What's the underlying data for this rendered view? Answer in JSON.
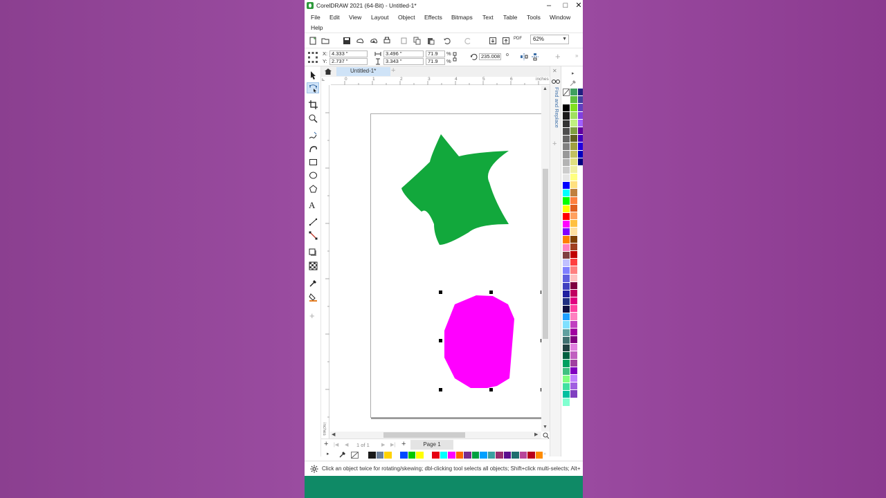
{
  "window": {
    "title": "CorelDRAW 2021 (64-Bit) - Untitled-1*",
    "min_glyph": "–",
    "max_glyph": "□",
    "close_glyph": "✕"
  },
  "menu": {
    "items": [
      "File",
      "Edit",
      "View",
      "Layout",
      "Object",
      "Effects",
      "Bitmaps",
      "Text",
      "Table",
      "Tools",
      "Window",
      "Help"
    ]
  },
  "toolbar": {
    "zoom_value": "62%",
    "pdf_label": "PDF"
  },
  "property_bar": {
    "x_label": "X:",
    "x_value": "4.333 \"",
    "y_label": "Y:",
    "y_value": "2.737 \"",
    "width_value": "3.496 \"",
    "height_value": "3.343 \"",
    "scale_w": "71.9",
    "scale_h": "71.9",
    "percent_symbol": "%",
    "rotation_value": "235.008",
    "degree_symbol": "o"
  },
  "document_tabs": {
    "active_tab": "Untitled-1*",
    "add_glyph": "+"
  },
  "ruler": {
    "unit_label": "inches",
    "h_ticks": [
      "0",
      "1",
      "2",
      "3",
      "4",
      "5",
      "6"
    ],
    "v_unit_label": "inches"
  },
  "page_navigator": {
    "count_text": "1  of  1",
    "page_tab": "Page 1"
  },
  "dockers": {
    "find_replace_title": "Find and Replace"
  },
  "status": {
    "text": "Click an object twice for rotating/skewing; dbl-clicking tool selects all objects; Shift+click multi-selects; Alt+"
  },
  "shapes": {
    "star_color": "#12a83c",
    "octagon_color": "#ff00ff"
  },
  "colors": {
    "accent": "#3b6ea8",
    "status_bar_bottom": "#0f8a66"
  },
  "doc_palette_colors": [
    "#1a1a1a",
    "#6b7f9a",
    "#ffd200",
    "#ffffff",
    "#0048ff",
    "#00c800",
    "#ffff00",
    "#ffffff",
    "#e60012",
    "#00ffff",
    "#ff00ff",
    "#ff6600",
    "#7a2d8e",
    "#00a040",
    "#00a0ff",
    "#3aa0a0",
    "#9a2d6e",
    "#5b0f8e",
    "#1f6e6e",
    "#b8459a",
    "#b8001b",
    "#ff8c00"
  ],
  "palette_col1": [
    "#ffffff",
    "#000000",
    "#1a1a1a",
    "#333333",
    "#4d4d4d",
    "#666666",
    "#808080",
    "#999999",
    "#b3b3b3",
    "#cccccc",
    "#e6e6e6",
    "#0000ff",
    "#00ffff",
    "#00ff00",
    "#ffff00",
    "#ff0000",
    "#ff00ff",
    "#8000ff",
    "#ff8000",
    "#ff80c0",
    "#804040",
    "#c0c0ff",
    "#8080ff",
    "#6060e0",
    "#4040c0",
    "#2020a0",
    "#203080",
    "#101040",
    "#20a0ff",
    "#80e0ff",
    "#60a0a0",
    "#407070",
    "#204040",
    "#006040",
    "#00a060",
    "#40c080",
    "#80ff80",
    "#40e0a0",
    "#00c0a0",
    "#80ffd0"
  ],
  "palette_col2": [
    "#40a060",
    "#60c040",
    "#80e020",
    "#a0e060",
    "#c0f080",
    "#80a040",
    "#606020",
    "#a0a040",
    "#c0c060",
    "#e0e080",
    "#f0f0a0",
    "#ffff80",
    "#ffe080",
    "#c08040",
    "#ff8040",
    "#e06020",
    "#ffa060",
    "#ffc040",
    "#ffe0a0",
    "#804000",
    "#a04020",
    "#c00000",
    "#ff4040",
    "#ff8080",
    "#ffc0c0",
    "#800040",
    "#c00060",
    "#e00080",
    "#ff40a0",
    "#ff80c0",
    "#c040c0",
    "#a000a0",
    "#800080",
    "#e080e0",
    "#c060c0",
    "#a040a0",
    "#8000c0",
    "#c080ff",
    "#a060e0",
    "#8040c0"
  ],
  "palette_col3": [
    "#202080",
    "#4040a0",
    "#6040c0",
    "#8040e0",
    "#a060ff",
    "#6000a0",
    "#4000c0",
    "#2000e0",
    "#0000c0",
    "#000080"
  ]
}
